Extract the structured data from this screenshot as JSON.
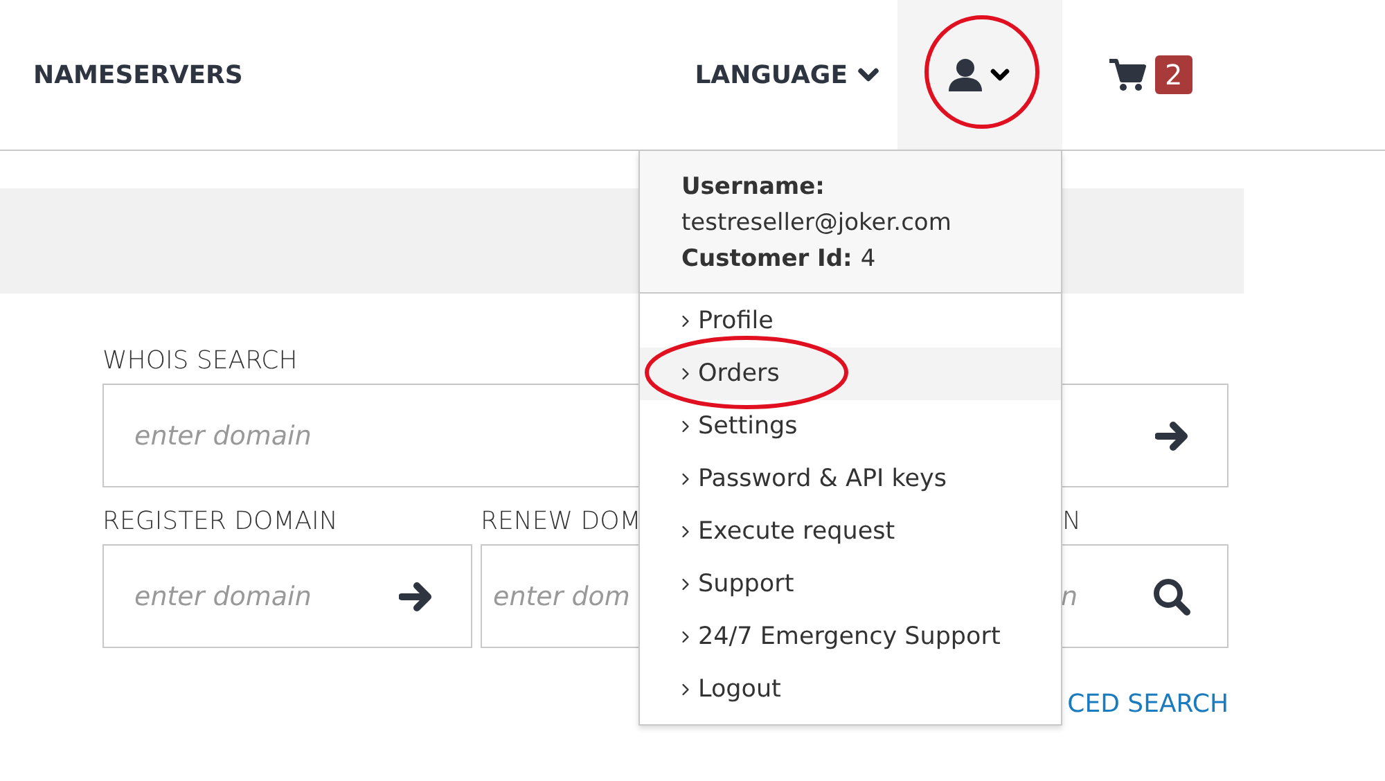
{
  "nav": {
    "title": "NAMESERVERS",
    "language": "LANGUAGE",
    "user_menu": {
      "open": true,
      "annotated": true
    },
    "cart_count": "2"
  },
  "search": {
    "whois": {
      "label": "WHOIS SEARCH",
      "placeholder": "enter domain"
    },
    "fields": [
      {
        "label": "REGISTER DOMAIN",
        "placeholder": "enter domain",
        "kind": "arrow"
      },
      {
        "label": "RENEW DOM",
        "placeholder": "enter dom",
        "kind": "plain"
      },
      {
        "label": "N",
        "placeholder": "n",
        "kind": "search"
      }
    ],
    "advanced_link": "CED SEARCH"
  },
  "dropdown": {
    "username_label": "Username:",
    "username": "testreseller@joker.com",
    "customer_id_label": "Customer Id:",
    "customer_id": "4",
    "items": [
      {
        "label": "Profile",
        "selected": false,
        "annotated": false
      },
      {
        "label": "Orders",
        "selected": true,
        "annotated": true
      },
      {
        "label": "Settings",
        "selected": false,
        "annotated": false
      },
      {
        "label": "Password & API keys",
        "selected": false,
        "annotated": false
      },
      {
        "label": "Execute request",
        "selected": false,
        "annotated": false
      },
      {
        "label": "Support",
        "selected": false,
        "annotated": false
      },
      {
        "label": "24/7 Emergency Support",
        "selected": false,
        "annotated": false
      },
      {
        "label": "Logout",
        "selected": false,
        "annotated": false
      }
    ]
  }
}
